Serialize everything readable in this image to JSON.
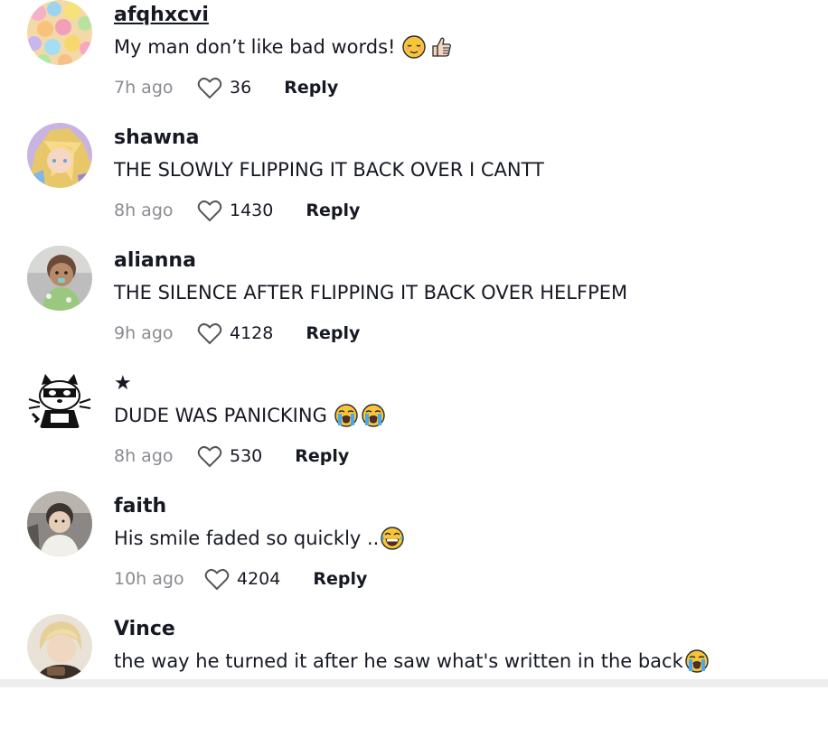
{
  "comments": [
    {
      "username": "afqhxcvi",
      "text": "My man don’t like bad words!",
      "emojis": [
        "relieved",
        "thumbs-up"
      ],
      "time": "7h ago",
      "likes": "36",
      "reply": "Reply",
      "underlined": true
    },
    {
      "username": "shawna",
      "text": "THE SLOWLY FLIPPING IT BACK OVER I CANTT",
      "emojis": [],
      "time": "8h ago",
      "likes": "1430",
      "reply": "Reply"
    },
    {
      "username": "alianna",
      "text": "THE SILENCE AFTER FLIPPING IT BACK OVER HELFPEM",
      "emojis": [],
      "time": "9h ago",
      "likes": "4128",
      "reply": "Reply"
    },
    {
      "username": "★",
      "text": "DUDE WAS PANICKING",
      "emojis": [
        "loudly-crying",
        "loudly-crying"
      ],
      "time": "8h ago",
      "likes": "530",
      "reply": "Reply"
    },
    {
      "username": "faith",
      "text": "His smile faded so quickly ..",
      "emojis": [
        "tears-of-joy"
      ],
      "time": "10h ago",
      "likes": "4204",
      "reply": "Reply"
    },
    {
      "username": "Vince",
      "text": "the way he turned it after he saw what's written in the back",
      "emojis": [
        "loudly-crying"
      ],
      "time": "",
      "likes": "",
      "reply": ""
    }
  ]
}
